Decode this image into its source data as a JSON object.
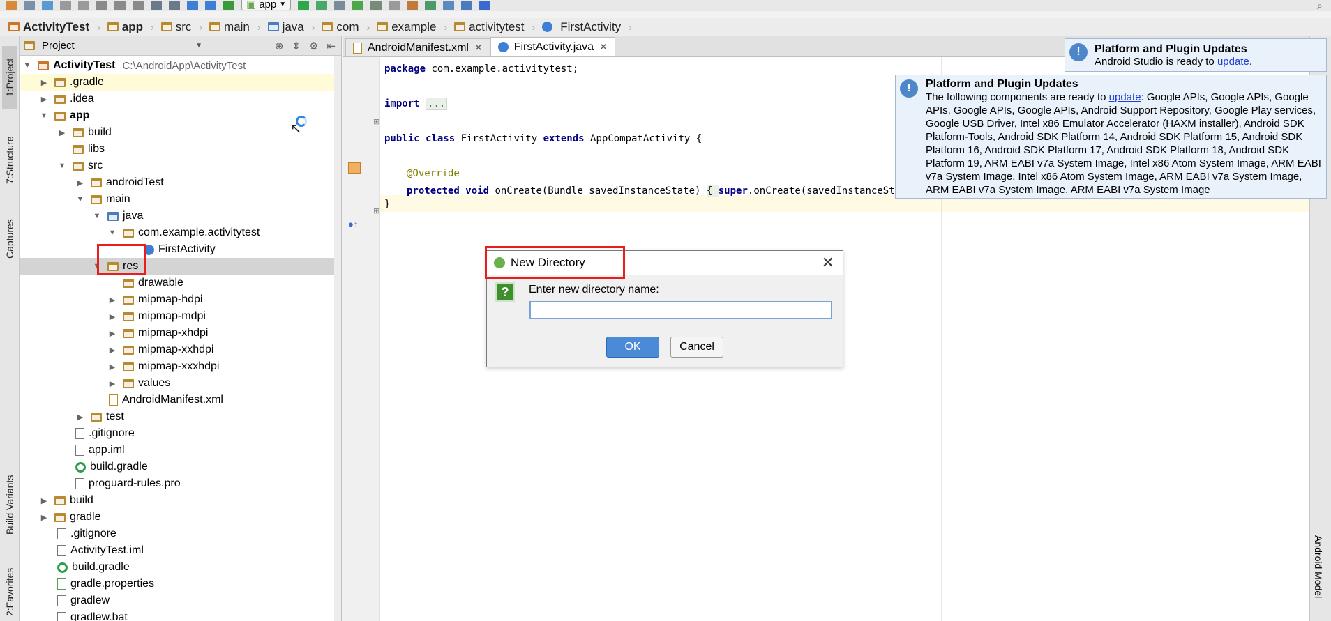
{
  "toolbar": {
    "run_config": "app"
  },
  "breadcrumb": [
    "ActivityTest",
    "app",
    "src",
    "main",
    "java",
    "com",
    "example",
    "activitytest",
    "FirstActivity"
  ],
  "left_strip": {
    "project": "1:Project",
    "structure": "7:Structure",
    "captures": "Captures",
    "build_variants": "Build Variants",
    "favorites": "2:Favorites"
  },
  "right_strip": {
    "android_model": "Android Model"
  },
  "project_panel": {
    "header": "Project",
    "root_name": "ActivityTest",
    "root_path": "C:\\AndroidApp\\ActivityTest",
    "items": [
      ".gradle",
      ".idea",
      "app",
      "build",
      "libs",
      "src",
      "androidTest",
      "main",
      "java",
      "com.example.activitytest",
      "FirstActivity",
      "res",
      "drawable",
      "mipmap-hdpi",
      "mipmap-mdpi",
      "mipmap-xhdpi",
      "mipmap-xxhdpi",
      "mipmap-xxxhdpi",
      "values",
      "AndroidManifest.xml",
      "test",
      ".gitignore",
      "app.iml",
      "build.gradle",
      "proguard-rules.pro",
      "build",
      "gradle",
      ".gitignore",
      "ActivityTest.iml",
      "build.gradle",
      "gradle.properties",
      "gradlew",
      "gradlew.bat"
    ]
  },
  "editor": {
    "tabs": [
      "AndroidManifest.xml",
      "FirstActivity.java"
    ],
    "code": {
      "l1_kw": "package",
      "l1_rest": " com.example.activitytest;",
      "l2_kw": "import",
      "l2_fold": "...",
      "l3_kw": "public class",
      "l3_name": " FirstActivity ",
      "l3_kw2": "extends",
      "l3_rest": " AppCompatActivity {",
      "l4_ann": "@Override",
      "l5_kw": "protected void",
      "l5_rest": " onCreate(Bundle savedInstanceState) ",
      "l5_brace": "{ ",
      "l5_kw2": "super",
      "l5_rest2": ".onCreate(savedInstanceState",
      "l6": "}"
    }
  },
  "balloon_small": {
    "title": "Platform and Plugin Updates",
    "text_prefix": "Android Studio is ready to ",
    "link": "update",
    "text_suffix": "."
  },
  "balloon_large": {
    "title": "Platform and Plugin Updates",
    "text_prefix": "The following components are ready to ",
    "link": "update",
    "text_suffix": ": Google APIs, Google APIs, Google APIs, Google APIs, Google APIs, Android Support Repository, Google Play services, Google USB Driver, Intel x86 Emulator Accelerator (HAXM installer), Android SDK Platform-Tools, Android SDK Platform 14, Android SDK Platform 15, Android SDK Platform 16, Android SDK Platform 17, Android SDK Platform 18, Android SDK Platform 19, ARM EABI v7a System Image, Intel x86 Atom System Image, ARM EABI v7a System Image, Intel x86 Atom System Image, ARM EABI v7a System Image, ARM EABI v7a System Image, ARM EABI v7a System Image"
  },
  "dialog": {
    "title": "New Directory",
    "prompt": "Enter new directory name:",
    "input_value": "",
    "ok": "OK",
    "cancel": "Cancel"
  },
  "colors": {
    "highlight_box": "#e81e1e",
    "ok_button": "#4a8ad6",
    "selection": "#d4d4d4"
  }
}
